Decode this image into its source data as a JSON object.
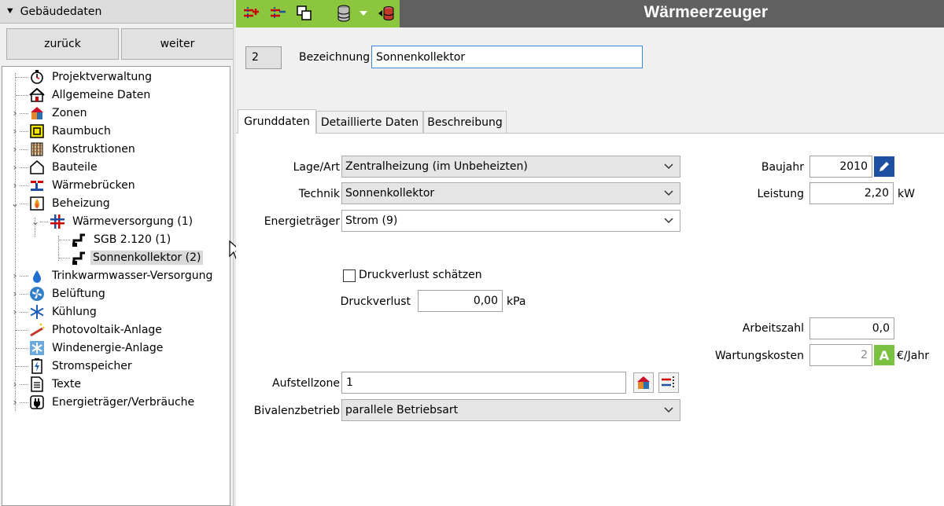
{
  "left": {
    "header": "Gebäudedaten",
    "back_button": "zurück",
    "next_button": "weiter",
    "tree": [
      {
        "label": "Projektverwaltung",
        "icon": "stopwatch-icon"
      },
      {
        "label": "Allgemeine Daten",
        "icon": "house-icon"
      },
      {
        "label": "Zonen",
        "icon": "zone-house-icon"
      },
      {
        "label": "Raumbuch",
        "icon": "room-book-icon"
      },
      {
        "label": "Konstruktionen",
        "icon": "construction-icon"
      },
      {
        "label": "Bauteile",
        "icon": "building-outline-icon"
      },
      {
        "label": "Wärmebrücken",
        "icon": "thermal-bridge-icon"
      },
      {
        "label": "Beheizung",
        "icon": "flame-icon"
      },
      {
        "label": "Wärmeversorgung (1)",
        "icon": "heat-supply-icon"
      },
      {
        "label": "SGB 2.120 (1)",
        "icon": "pipe-icon"
      },
      {
        "label": "Sonnenkollektor (2)",
        "icon": "pipe-icon"
      },
      {
        "label": "Trinkwarmwasser-Versorgung",
        "icon": "water-drop-icon"
      },
      {
        "label": "Belüftung",
        "icon": "fan-icon"
      },
      {
        "label": "Kühlung",
        "icon": "snowflake-icon"
      },
      {
        "label": "Photovoltaik-Anlage",
        "icon": "photovoltaic-icon"
      },
      {
        "label": "Windenergie-Anlage",
        "icon": "wind-energy-icon"
      },
      {
        "label": "Stromspeicher",
        "icon": "battery-icon"
      },
      {
        "label": "Texte",
        "icon": "document-icon"
      },
      {
        "label": "Energieträger/Verbräuche",
        "icon": "plug-icon"
      }
    ]
  },
  "toolbar": {
    "title": "Wärmeerzeuger",
    "icons": [
      "add-red-icon",
      "remove-red-icon",
      "copy-icon",
      "database-icon",
      "dropdown-arrow-icon",
      "database-red-icon"
    ]
  },
  "header": {
    "number": "2",
    "bezeichnung_label": "Bezeichnung",
    "bezeichnung_value": "Sonnenkollektor"
  },
  "tabs": [
    "Grunddaten",
    "Detaillierte Daten",
    "Beschreibung"
  ],
  "form": {
    "lage_label": "Lage/Art",
    "lage_value": "Zentralheizung (im Unbeheizten)",
    "technik_label": "Technik",
    "technik_value": "Sonnenkollektor",
    "energie_label": "Energieträger",
    "energie_value": "Strom (9)",
    "druckverlust_check_label": "Druckverlust schätzen",
    "druckverlust_label": "Druckverlust",
    "druckverlust_value": "0,00",
    "druckverlust_unit": "kPa",
    "baujahr_label": "Baujahr",
    "baujahr_value": "2010",
    "leistung_label": "Leistung",
    "leistung_value": "2,20",
    "leistung_unit": "kW",
    "arbeitszahl_label": "Arbeitszahl",
    "arbeitszahl_value": "0,0",
    "wartung_label": "Wartungskosten",
    "wartung_value": "2",
    "wartung_badge": "A",
    "wartung_unit": "€/Jahr",
    "aufstell_label": "Aufstellzone",
    "aufstell_value": "1",
    "bivalenz_label": "Bivalenzbetrieb",
    "bivalenz_value": "parallele Betriebsart"
  },
  "colors": {
    "toolbar_green": "#8cc63f",
    "toolbar_gray": "#606060",
    "focus_blue": "#3c86d6",
    "badge_green": "#7ac142"
  }
}
